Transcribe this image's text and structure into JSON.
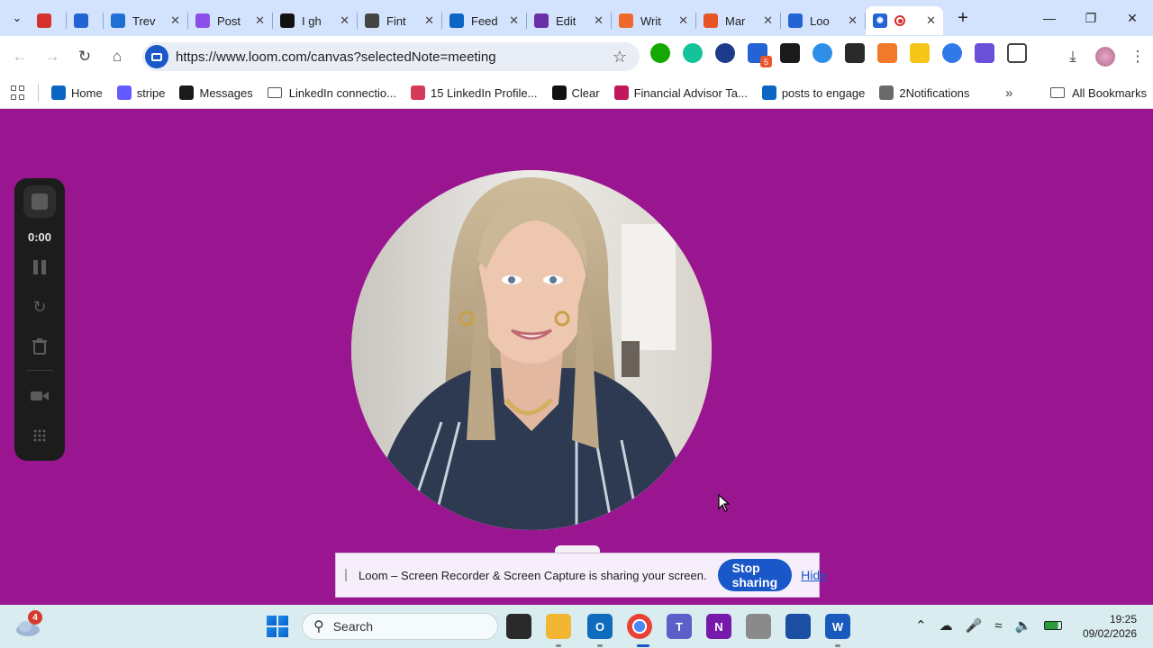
{
  "browser": {
    "tabs": [
      {
        "title": "",
        "favicon": "loom-record-icon",
        "color": "#d6322d",
        "narrow": true
      },
      {
        "title": "",
        "favicon": "loom-gear-icon",
        "color": "#2463d4",
        "narrow": true
      },
      {
        "title": "Trev",
        "favicon": "v-icon",
        "color": "#1f6fd4"
      },
      {
        "title": "Post",
        "favicon": "post-icon",
        "color": "#8a4fe8"
      },
      {
        "title": "I gh",
        "favicon": "x-logo-icon",
        "color": "#111111"
      },
      {
        "title": "Fint",
        "favicon": "openai-icon",
        "color": "#444444"
      },
      {
        "title": "Feed",
        "favicon": "linkedin-icon",
        "color": "#0a66c2"
      },
      {
        "title": "Edit",
        "favicon": "edit-icon",
        "color": "#6b2fa8"
      },
      {
        "title": "Writ",
        "favicon": "write-icon",
        "color": "#ef6a2a"
      },
      {
        "title": "Mar",
        "favicon": "bookmark-icon",
        "color": "#e85524"
      },
      {
        "title": "Loo",
        "favicon": "loom-icon",
        "color": "#2463d4"
      }
    ],
    "active_tab": {
      "title": "",
      "favicon": "loom-icon",
      "color": "#2463d4"
    },
    "url": "https://www.loom.com/canvas?selectedNote=meeting"
  },
  "bookmarks": [
    {
      "label": "Home",
      "icon": "linkedin-icon",
      "color": "#0a66c2"
    },
    {
      "label": "stripe",
      "icon": "stripe-icon",
      "color": "#635bff"
    },
    {
      "label": "Messages",
      "icon": "upwork-icon",
      "color": "#1a1a1a"
    },
    {
      "label": "LinkedIn connectio...",
      "icon": "folder-icon",
      "color": ""
    },
    {
      "label": "15 LinkedIn Profile...",
      "icon": "v-heart-icon",
      "color": "#d63a5a"
    },
    {
      "label": "Clear",
      "icon": "uo-icon",
      "color": "#111111"
    },
    {
      "label": "Financial Advisor Ta...",
      "icon": "swirl-icon",
      "color": "#c2185b"
    },
    {
      "label": "posts to engage",
      "icon": "linkedin-icon",
      "color": "#0a66c2"
    },
    {
      "label": "2Notifications",
      "icon": "globe-icon",
      "color": "#6a6a6a"
    }
  ],
  "bookmarks_all": "All Bookmarks",
  "recorder": {
    "time": "0:00"
  },
  "share_bar": {
    "message": "Loom – Screen Recorder & Screen Capture is sharing your screen.",
    "stop_label": "Stop sharing",
    "hide_label": "Hide"
  },
  "taskbar": {
    "weather_badge": "4",
    "search_placeholder": "Search",
    "time": "19:25",
    "date": "09/02/2026"
  },
  "colors": {
    "canvas_bg": "#9a1690",
    "accent": "#1a57c8"
  }
}
